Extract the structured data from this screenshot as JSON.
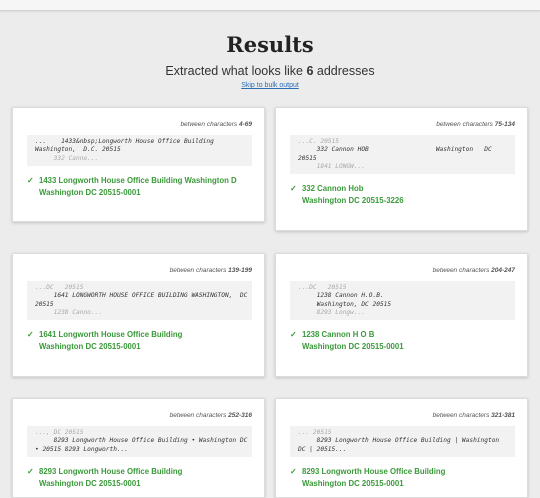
{
  "title": "Results",
  "subtitle": {
    "prefix": "Extracted what looks like ",
    "count": "6",
    "suffix": " addresses"
  },
  "skip_link": "Skip to bulk output",
  "cards": [
    {
      "range_prefix": "between characters ",
      "range": "4-69",
      "snippet": [
        {
          "text": "...    1433&nbsp;Longworth House Office Building",
          "faint": false
        },
        {
          "text": "Washington,  D.C. 20515",
          "faint": false
        },
        {
          "text": "     332 Canno...",
          "faint": true
        }
      ],
      "result": [
        "1433 Longworth House Office Building Washington D",
        "Washington DC 20515-0001"
      ]
    },
    {
      "range_prefix": "between characters ",
      "range": "75-134",
      "snippet": [
        {
          "text": "...C. 20515",
          "faint": true
        },
        {
          "text": "     332 Cannon HOB                  Washington   DC",
          "faint": false
        },
        {
          "text": "20515",
          "faint": false
        },
        {
          "text": "     1841 LONGW...",
          "faint": true
        }
      ],
      "result": [
        "332 Cannon Hob",
        "Washington DC 20515-3226"
      ]
    },
    {
      "range_prefix": "between characters ",
      "range": "139-199",
      "snippet": [
        {
          "text": "...DC   20515",
          "faint": true
        },
        {
          "text": "     1641 LONGWORTH HOUSE OFFICE BUILDING WASHINGTON,  DC",
          "faint": false
        },
        {
          "text": "20515",
          "faint": false
        },
        {
          "text": "     1238 Canno...",
          "faint": true
        }
      ],
      "result": [
        "1641 Longworth House Office Building",
        "Washington DC 20515-0001"
      ]
    },
    {
      "range_prefix": "between characters ",
      "range": "204-247",
      "snippet": [
        {
          "text": "...DC   20515",
          "faint": true
        },
        {
          "text": "     1238 Cannon H.O.B.",
          "faint": false
        },
        {
          "text": "     Washington, DC 20515",
          "faint": false
        },
        {
          "text": "     8293 Longw...",
          "faint": true
        }
      ],
      "result": [
        "1238 Cannon H O B",
        "Washington DC 20515-0001"
      ]
    },
    {
      "range_prefix": "between characters ",
      "range": "252-316",
      "snippet": [
        {
          "text": "..., DC 20515",
          "faint": true
        },
        {
          "text": "     8293 Longworth House Office Building • Washington DC",
          "faint": false
        },
        {
          "text": "• 20515 8293 Longworth...",
          "faint": false
        }
      ],
      "result": [
        "8293 Longworth House Office Building",
        "Washington DC 20515-0001"
      ]
    },
    {
      "range_prefix": "between characters ",
      "range": "321-381",
      "snippet": [
        {
          "text": "... 20515",
          "faint": true
        },
        {
          "text": "     8293 Longworth House Office Building | Washington",
          "faint": false
        },
        {
          "text": "DC | 20515...",
          "faint": false
        }
      ],
      "result": [
        "8293 Longworth House Office Building",
        "Washington DC 20515-0001"
      ]
    }
  ]
}
